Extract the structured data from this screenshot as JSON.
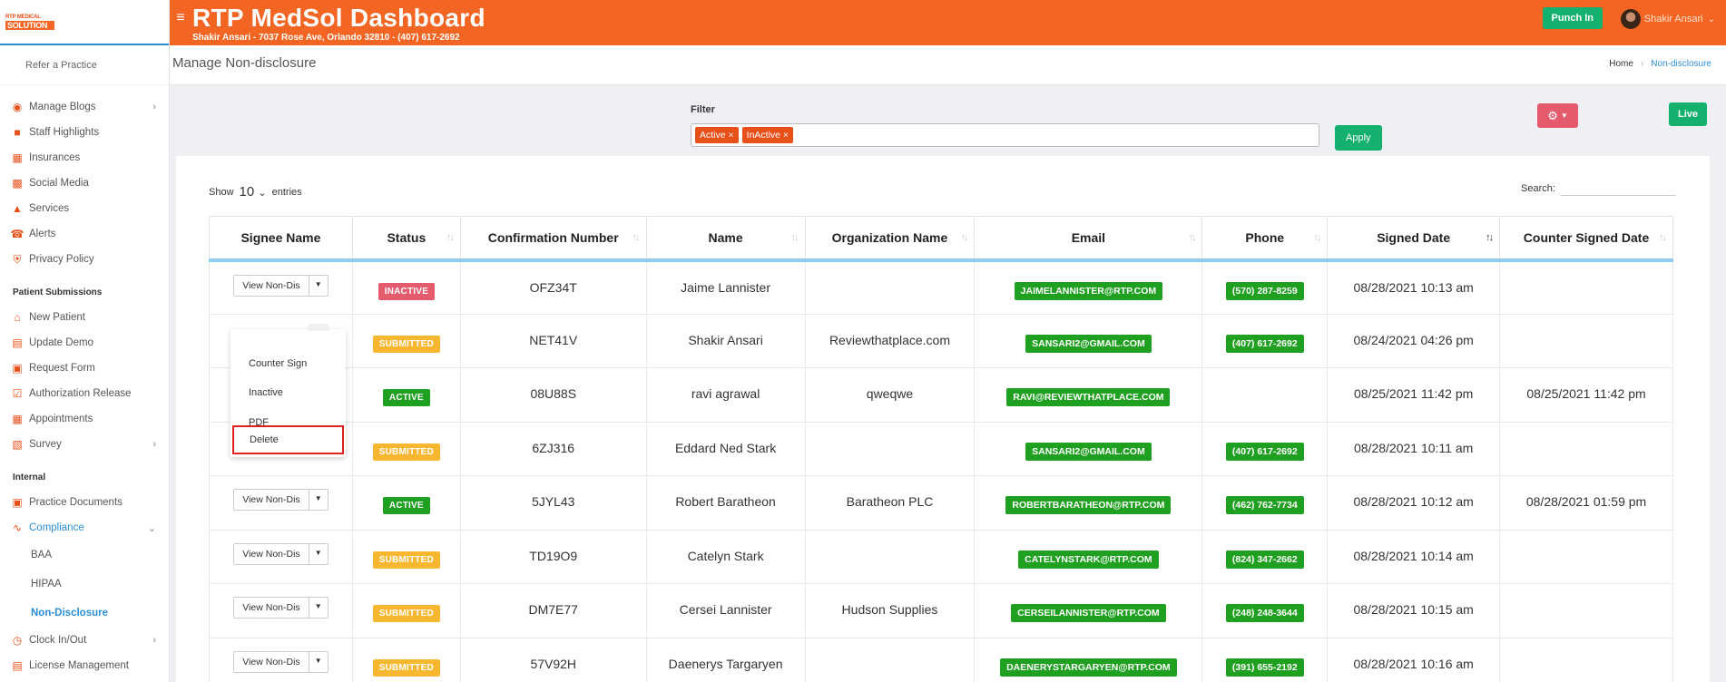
{
  "app": {
    "logo_line1": "RTP MEDICAL",
    "logo_line2": "SOLUTION",
    "title": "RTP MedSol Dashboard",
    "subtitle": "Shakir Ansari - 7037 Rose Ave, Orlando 32810 - (407) 617-2692",
    "punch_in": "Punch In",
    "user_name": "Shakir Ansari"
  },
  "sidebar": {
    "refer": "Refer a Practice",
    "items": [
      {
        "label": "Manage Blogs",
        "icon": "blog-icon",
        "chevron": true
      },
      {
        "label": "Staff Highlights",
        "icon": "staff-icon"
      },
      {
        "label": "Insurances",
        "icon": "insurance-icon"
      },
      {
        "label": "Social Media",
        "icon": "social-icon"
      },
      {
        "label": "Services",
        "icon": "services-icon"
      },
      {
        "label": "Alerts",
        "icon": "alerts-icon"
      },
      {
        "label": "Privacy Policy",
        "icon": "privacy-icon"
      }
    ],
    "section_patient": "Patient Submissions",
    "patient_items": [
      {
        "label": "New Patient",
        "icon": "home-icon"
      },
      {
        "label": "Update Demo",
        "icon": "id-card-icon"
      },
      {
        "label": "Request Form",
        "icon": "form-icon"
      },
      {
        "label": "Authorization Release",
        "icon": "check-icon"
      },
      {
        "label": "Appointments",
        "icon": "calendar-icon"
      },
      {
        "label": "Survey",
        "icon": "survey-icon",
        "chevron": true
      }
    ],
    "section_internal": "Internal",
    "internal_items": [
      {
        "label": "Practice Documents",
        "icon": "documents-icon"
      },
      {
        "label": "Compliance",
        "icon": "signature-icon",
        "chevron": true
      },
      {
        "label": "BAA"
      },
      {
        "label": "HIPAA"
      },
      {
        "label": "Non-Disclosure"
      },
      {
        "label": "Clock In/Out",
        "icon": "clock-icon",
        "chevron": true
      },
      {
        "label": "License Management",
        "icon": "license-icon"
      }
    ]
  },
  "page": {
    "title": "Manage Non-disclosure",
    "breadcrumb_home": "Home",
    "breadcrumb_current": "Non-disclosure"
  },
  "filter": {
    "label": "Filter",
    "chips": [
      "Active ×",
      "InActive ×"
    ],
    "apply": "Apply",
    "live": "Live"
  },
  "table_controls": {
    "show": "Show",
    "entries_value": "10",
    "entries": "entries",
    "search": "Search:"
  },
  "columns": [
    "Signee Name",
    "Status",
    "Confirmation Number",
    "Name",
    "Organization Name",
    "Email",
    "Phone",
    "Signed Date",
    "Counter Signed Date"
  ],
  "action_label": "View Non-Dis",
  "rows": [
    {
      "status": "INACTIVE",
      "status_type": "inactive",
      "conf": "OFZ34T",
      "name": "Jaime Lannister",
      "org": "",
      "email": "JAIMELANNISTER@RTP.COM",
      "phone": "(570) 287-8259",
      "signed": "08/28/2021 10:13 am",
      "counter": ""
    },
    {
      "status": "SUBMITTED",
      "status_type": "submitted",
      "conf": "NET41V",
      "name": "Shakir Ansari",
      "org": "Reviewthatplace.com",
      "email": "SANSARI2@GMAIL.COM",
      "phone": "(407) 617-2692",
      "signed": "08/24/2021 04:26 pm",
      "counter": ""
    },
    {
      "status": "ACTIVE",
      "status_type": "active",
      "conf": "08U88S",
      "name": "ravi agrawal",
      "org": "qweqwe",
      "email": "RAVI@REVIEWTHATPLACE.COM",
      "phone": "",
      "signed": "08/25/2021 11:42 pm",
      "counter": "08/25/2021 11:42 pm"
    },
    {
      "status": "SUBMITTED",
      "status_type": "submitted",
      "conf": "6ZJ316",
      "name": "Eddard Ned Stark",
      "org": "",
      "email": "SANSARI2@GMAIL.COM",
      "phone": "(407) 617-2692",
      "signed": "08/28/2021 10:11 am",
      "counter": ""
    },
    {
      "status": "ACTIVE",
      "status_type": "active",
      "conf": "5JYL43",
      "name": "Robert Baratheon",
      "org": "Baratheon PLC",
      "email": "ROBERTBARATHEON@RTP.COM",
      "phone": "(462) 762-7734",
      "signed": "08/28/2021 10:12 am",
      "counter": "08/28/2021 01:59 pm"
    },
    {
      "status": "SUBMITTED",
      "status_type": "submitted",
      "conf": "TD19O9",
      "name": "Catelyn Stark",
      "org": "",
      "email": "CATELYNSTARK@RTP.COM",
      "phone": "(824) 347-2662",
      "signed": "08/28/2021 10:14 am",
      "counter": ""
    },
    {
      "status": "SUBMITTED",
      "status_type": "submitted",
      "conf": "DM7E77",
      "name": "Cersei Lannister",
      "org": "Hudson Supplies",
      "email": "CERSEILANNISTER@RTP.COM",
      "phone": "(248) 248-3644",
      "signed": "08/28/2021 10:15 am",
      "counter": ""
    },
    {
      "status": "SUBMITTED",
      "status_type": "submitted",
      "conf": "57V92H",
      "name": "Daenerys Targaryen",
      "org": "",
      "email": "DAENERYSTARGARYEN@RTP.COM",
      "phone": "(391) 655-2192",
      "signed": "08/28/2021 10:16 am",
      "counter": ""
    }
  ],
  "dropdown": [
    "Counter Sign",
    "Inactive",
    "PDF",
    "Delete"
  ]
}
